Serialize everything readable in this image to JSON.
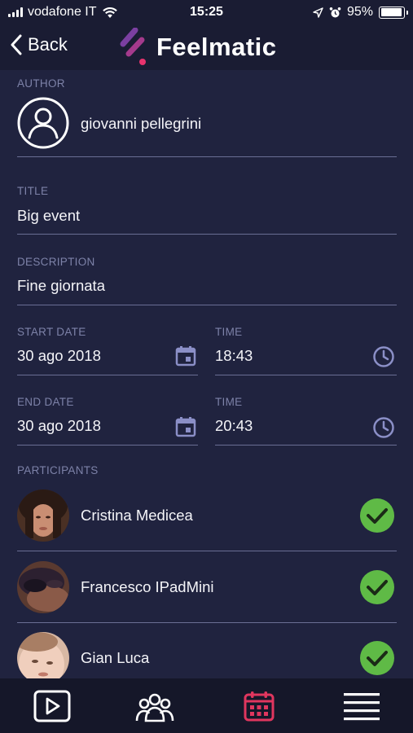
{
  "status_bar": {
    "carrier": "vodafone IT",
    "time": "15:25",
    "battery_percent": "95%",
    "battery_level": 0.95,
    "icons": [
      "signal-icon",
      "wifi-icon",
      "location-arrow-icon",
      "alarm-icon",
      "battery-icon"
    ]
  },
  "header": {
    "back_label": "Back",
    "brand_name": "Feelmatic"
  },
  "colors": {
    "background": "#20233f",
    "header": "#1a1c33",
    "label": "#7d82a8",
    "divider": "#6a6e94",
    "accent_icon": "#8b8fc7",
    "check_green": "#5fba46",
    "brand_purple": "#7b3fa1",
    "brand_pink": "#e8336e",
    "active_tab": "#e0365e"
  },
  "form": {
    "author": {
      "label": "AUTHOR",
      "value": "giovanni pellegrini"
    },
    "title": {
      "label": "TITLE",
      "value": "Big event"
    },
    "description": {
      "label": "DESCRIPTION",
      "value": "Fine giornata"
    },
    "start_date": {
      "label": "START DATE",
      "value": "30 ago 2018"
    },
    "start_time": {
      "label": "TIME",
      "value": "18:43"
    },
    "end_date": {
      "label": "END DATE",
      "value": "30 ago 2018"
    },
    "end_time": {
      "label": "TIME",
      "value": "20:43"
    }
  },
  "participants": {
    "label": "PARTICIPANTS",
    "items": [
      {
        "name": "Cristina Medicea",
        "status": "confirmed"
      },
      {
        "name": "Francesco IPadMini",
        "status": "confirmed"
      },
      {
        "name": "Gian Luca",
        "status": "confirmed"
      }
    ]
  },
  "tabbar": {
    "tabs": [
      {
        "icon": "play-icon",
        "active": false
      },
      {
        "icon": "group-icon",
        "active": false
      },
      {
        "icon": "calendar-icon",
        "active": true
      },
      {
        "icon": "menu-icon",
        "active": false
      }
    ]
  }
}
